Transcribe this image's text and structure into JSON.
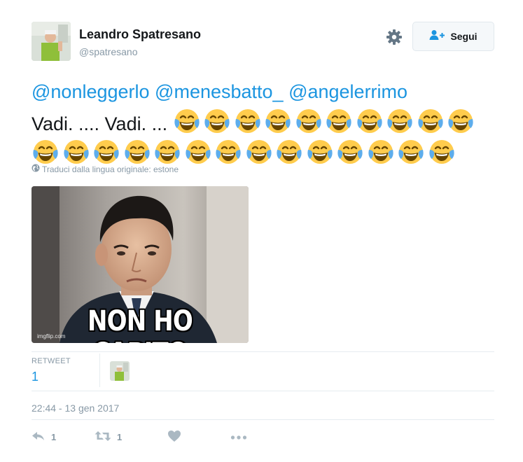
{
  "user": {
    "name": "Leandro Spatresano",
    "handle": "@spatresano"
  },
  "header": {
    "follow_label": "Segui"
  },
  "tweet": {
    "mentions": [
      "@nonleggerlo",
      "@menesbatto_",
      "@angelerrimo"
    ],
    "text": "Vadi. .... Vadi. ...",
    "emoji": "face-with-tears-of-joy",
    "emoji_count_line1": 10,
    "emoji_count_line2": 14,
    "translate_label": "Traduci dalla lingua originale: estone"
  },
  "media": {
    "caption": "NON HO CAPITO",
    "credit": "imgflip.com"
  },
  "stats": {
    "retweet_label": "RETWEET",
    "retweet_count": "1"
  },
  "timestamp": "22:44 - 13 gen 2017",
  "actions": {
    "reply_count": "1",
    "retweet_count": "1"
  },
  "colors": {
    "link": "#1b95e0",
    "muted": "#8899a6",
    "icon": "#aab8c2"
  }
}
